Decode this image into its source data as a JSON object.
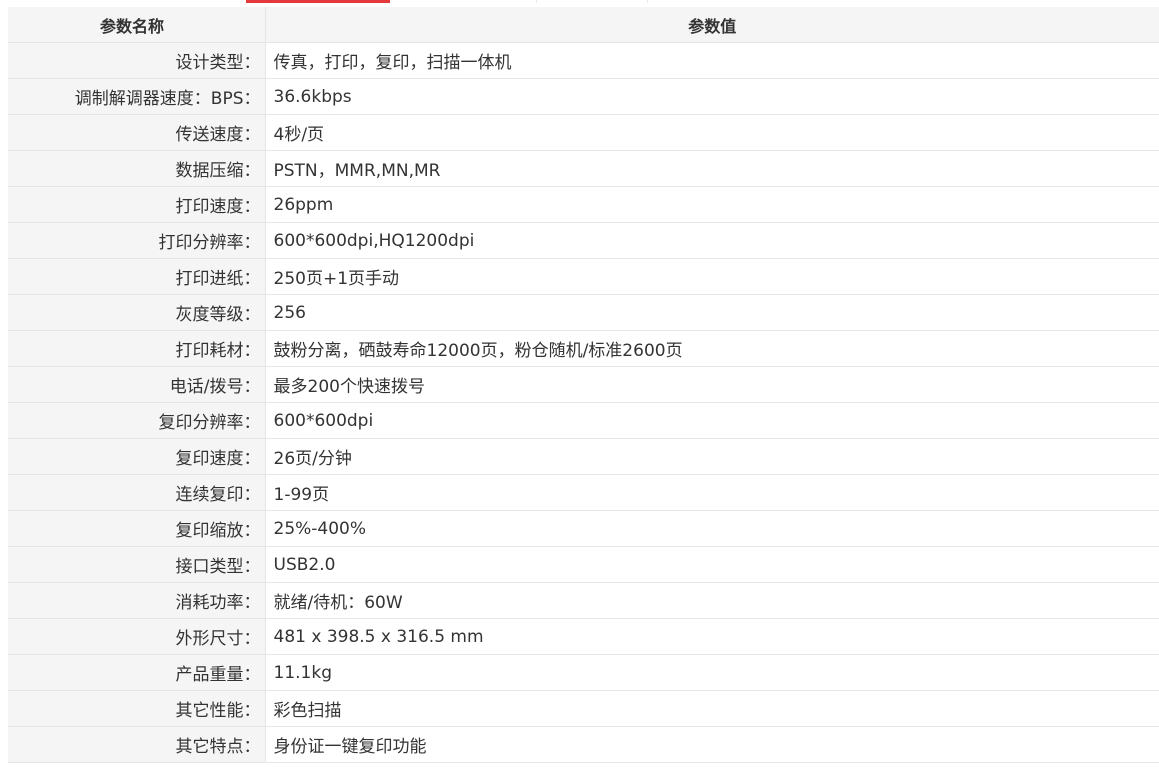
{
  "header": {
    "name_col": "参数名称",
    "value_col": "参数值"
  },
  "specs": [
    {
      "label": "设计类型：",
      "value": "传真，打印，复印，扫描一体机"
    },
    {
      "label": "调制解调器速度：BPS：",
      "value": "36.6kbps"
    },
    {
      "label": "传送速度：",
      "value": "4秒/页"
    },
    {
      "label": "数据压缩：",
      "value": "PSTN，MMR,MN,MR"
    },
    {
      "label": "打印速度：",
      "value": "26ppm"
    },
    {
      "label": "打印分辨率：",
      "value": "600*600dpi,HQ1200dpi"
    },
    {
      "label": "打印进纸：",
      "value": "250页+1页手动"
    },
    {
      "label": "灰度等级：",
      "value": "256"
    },
    {
      "label": "打印耗材：",
      "value": "鼓粉分离，硒鼓寿命12000页，粉仓随机/标准2600页"
    },
    {
      "label": "电话/拨号：",
      "value": "最多200个快速拨号"
    },
    {
      "label": "复印分辨率：",
      "value": "600*600dpi"
    },
    {
      "label": "复印速度：",
      "value": "26页/分钟"
    },
    {
      "label": "连续复印：",
      "value": "1-99页"
    },
    {
      "label": "复印缩放：",
      "value": "25%-400%"
    },
    {
      "label": "接口类型：",
      "value": "USB2.0"
    },
    {
      "label": "消耗功率：",
      "value": "就绪/待机：60W"
    },
    {
      "label": "外形尺寸：",
      "value": "481 x 398.5 x 316.5 mm"
    },
    {
      "label": "产品重量：",
      "value": "11.1kg"
    },
    {
      "label": "其它性能：",
      "value": "彩色扫描"
    },
    {
      "label": "其它特点：",
      "value": "身份证一键复印功能"
    }
  ],
  "colors": {
    "active_tab_accent": "#e4393c",
    "label_background": "#f5f5f5",
    "border": "#e6e6e6"
  }
}
